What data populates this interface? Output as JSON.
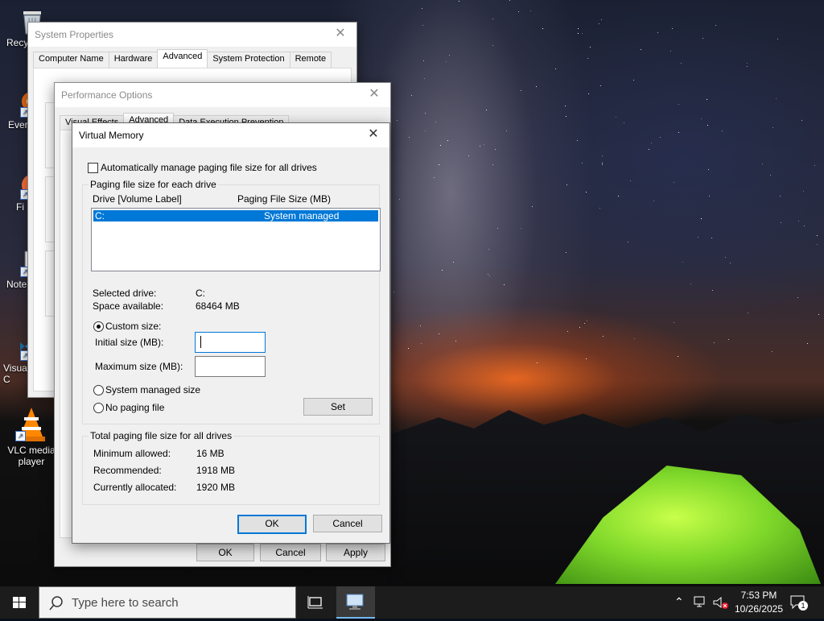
{
  "desktop": {
    "icons": [
      {
        "label": "Recy",
        "icon": "recycle-bin-icon"
      },
      {
        "label": "Ever",
        "icon": "everything-app-icon"
      },
      {
        "label": "Fi",
        "icon": "firefox-icon"
      },
      {
        "label": "Note",
        "icon": "notepad-plus-plus-icon"
      },
      {
        "label": "Visua C",
        "icon": "visual-studio-code-icon"
      },
      {
        "label": "VLC media player",
        "icon": "vlc-cone-icon"
      }
    ]
  },
  "system_properties": {
    "title": "System Properties",
    "tabs": [
      "Computer Name",
      "Hardware",
      "Advanced",
      "System Protection",
      "Remote"
    ],
    "selected_tab": "Advanced",
    "buttons": {
      "ok": "OK",
      "cancel": "Cancel",
      "apply": "Apply"
    }
  },
  "performance_options": {
    "title": "Performance Options",
    "tabs": [
      "Visual Effects",
      "Advanced",
      "Data Execution Prevention"
    ],
    "selected_tab": "Advanced"
  },
  "virtual_memory": {
    "title": "Virtual Memory",
    "auto_manage_label": "Automatically manage paging file size for all drives",
    "auto_manage_checked": false,
    "per_drive_group": "Paging file size for each drive",
    "col_drive": "Drive  [Volume Label]",
    "col_size": "Paging File Size (MB)",
    "drives": [
      {
        "drive": "C:",
        "size": "System managed"
      }
    ],
    "selected_drive_label": "Selected drive:",
    "selected_drive_value": "C:",
    "space_available_label": "Space available:",
    "space_available_value": "68464 MB",
    "custom_size_label": "Custom size:",
    "initial_size_label": "Initial size (MB):",
    "initial_size_value": "",
    "maximum_size_label": "Maximum size (MB):",
    "maximum_size_value": "",
    "system_managed_label": "System managed size",
    "no_paging_label": "No paging file",
    "selected_option": "custom",
    "set_button": "Set",
    "total_group": "Total paging file size for all drives",
    "minimum_label": "Minimum allowed:",
    "minimum_value": "16 MB",
    "recommended_label": "Recommended:",
    "recommended_value": "1918 MB",
    "allocated_label": "Currently allocated:",
    "allocated_value": "1920 MB",
    "ok_button": "OK",
    "cancel_button": "Cancel"
  },
  "taskbar": {
    "search_placeholder": "Type here to search",
    "time": "7:53 PM",
    "date": "10/26/2025",
    "notification_count": "1"
  },
  "colors": {
    "accent": "#0078d7",
    "taskbar": "#1c1c1c"
  }
}
